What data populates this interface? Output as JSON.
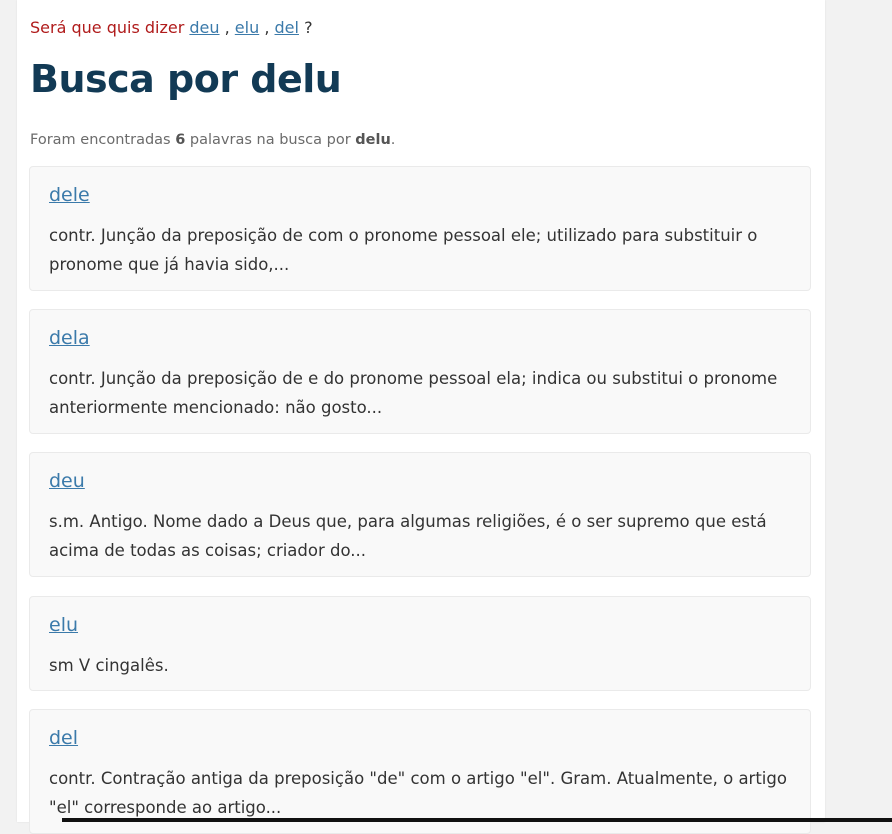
{
  "suggestion": {
    "lead": "Será que quis dizer",
    "links": [
      "deu",
      "elu",
      "del"
    ],
    "separator": ",",
    "end": "?"
  },
  "title": "Busca por delu",
  "summary": {
    "prefix": "Foram encontradas",
    "count": "6",
    "middle": "palavras na busca por",
    "term": "delu",
    "suffix": "."
  },
  "results": [
    {
      "word": "dele",
      "definition": "contr. Junção da preposição de com o pronome pessoal ele; utilizado para substituir o pronome que já havia sido,..."
    },
    {
      "word": "dela",
      "definition": "contr. Junção da preposição de e do pronome pessoal ela; indica ou substitui o pronome anteriormente mencionado: não gosto..."
    },
    {
      "word": "deu",
      "definition": "s.m. Antigo. Nome dado a Deus que, para algumas religiões, é o ser supremo que está acima de todas as coisas; criador do..."
    },
    {
      "word": "elu",
      "definition": "sm V cingalês."
    },
    {
      "word": "del",
      "definition": "contr. Contração antiga da preposição \"de\" com o artigo \"el\". Gram. Atualmente, o artigo \"el\" corresponde ao artigo..."
    }
  ]
}
